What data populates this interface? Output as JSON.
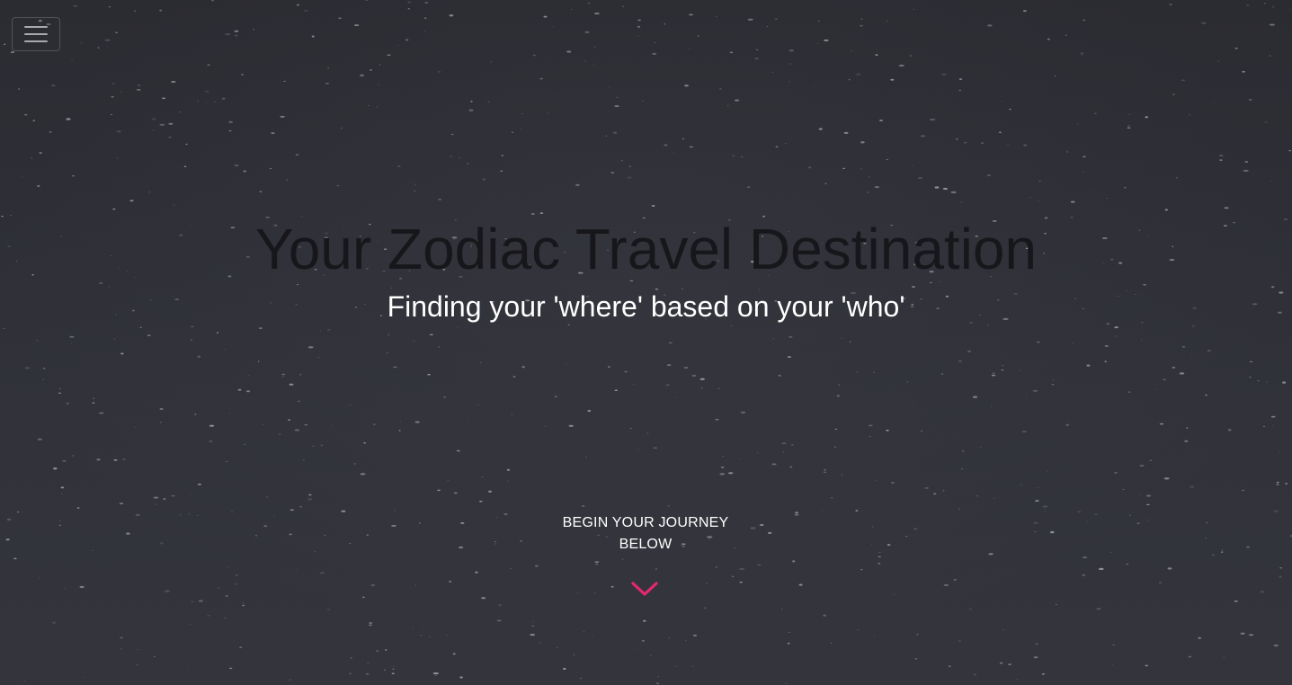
{
  "nav": {
    "menu_icon": "hamburger-menu-icon"
  },
  "hero": {
    "title": "Your Zodiac Travel Destination",
    "subtitle": "Finding your 'where' based on your 'who'"
  },
  "cta": {
    "line1": "BEGIN YOUR JOURNEY",
    "line2": "BELOW",
    "arrow_icon": "chevron-down-icon"
  },
  "colors": {
    "background": "#2e2f36",
    "title": "#17171b",
    "subtitle": "#ffffff",
    "accent": "#e8286e"
  }
}
